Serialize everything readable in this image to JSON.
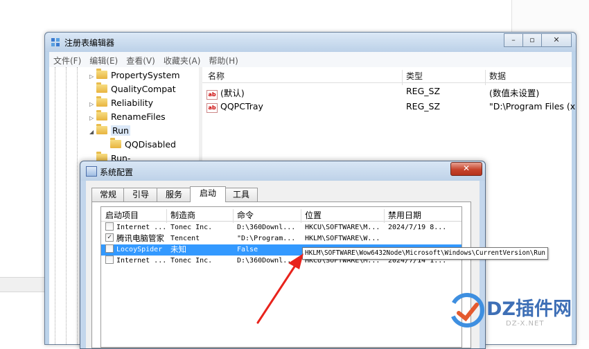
{
  "regedit": {
    "title": "注册表编辑器",
    "menu": [
      "文件(F)",
      "编辑(E)",
      "查看(V)",
      "收藏夹(A)",
      "帮助(H)"
    ],
    "window_buttons": [
      "–",
      "▫",
      "✕"
    ],
    "tree": [
      {
        "label": "PropertySystem",
        "expander": "▷"
      },
      {
        "label": "QualityCompat",
        "expander": ""
      },
      {
        "label": "Reliability",
        "expander": "▷"
      },
      {
        "label": "RenameFiles",
        "expander": "▷"
      },
      {
        "label": "Run",
        "expander": "◢"
      },
      {
        "label": "QQDisabled",
        "expander": ""
      },
      {
        "label": "Run-",
        "expander": ""
      }
    ],
    "columns": [
      "名称",
      "类型",
      "数据"
    ],
    "values": [
      {
        "name": "(默认)",
        "type": "REG_SZ",
        "data": "(数值未设置)",
        "icon": "ab-icon"
      },
      {
        "name": "QQPCTray",
        "type": "REG_SZ",
        "data": "\"D:\\Program Files (x",
        "icon": "ab-icon"
      }
    ]
  },
  "msconfig": {
    "title": "系统配置",
    "close_label": "✕",
    "tabs": [
      "常规",
      "引导",
      "服务",
      "启动",
      "工具"
    ],
    "active_tab": "启动",
    "columns": [
      "启动项目",
      "制造商",
      "命令",
      "位置",
      "禁用日期"
    ],
    "rows": [
      {
        "checked": false,
        "item": "Internet ...",
        "maker": "Tonec Inc.",
        "command": "D:\\360Downl...",
        "location": "HKCU\\SOFTWARE\\M...",
        "date": "2024/7/19 8..."
      },
      {
        "checked": true,
        "item": "腾讯电脑管家",
        "maker": "Tencent",
        "command": "\"D:\\Program...",
        "location": "HKLM\\SOFTWARE\\W...",
        "date": ""
      },
      {
        "checked": false,
        "item": "LocoySpider",
        "maker": "未知",
        "command": "False",
        "location": "HKLM\\SOFTWARE\\Wow6432Node\\Microsoft\\Windows\\CurrentVersion\\Run",
        "date": "",
        "selected": true
      },
      {
        "checked": false,
        "item": "Internet ...",
        "maker": "Tonec Inc.",
        "command": "D:\\360Downl...",
        "location": "HKCU\\SOFTWARE\\M...",
        "date": "2024/7/14 1..."
      }
    ],
    "tooltip": "HKLM\\SOFTWARE\\Wow6432Node\\Microsoft\\Windows\\CurrentVersion\\Run"
  },
  "watermark": {
    "text": "DZ插件网",
    "sub": "DZ-X.NET"
  },
  "colors": {
    "selection": "#3399ff",
    "annotation_arrow": "#e8231c",
    "watermark": "#3e6fb6"
  }
}
